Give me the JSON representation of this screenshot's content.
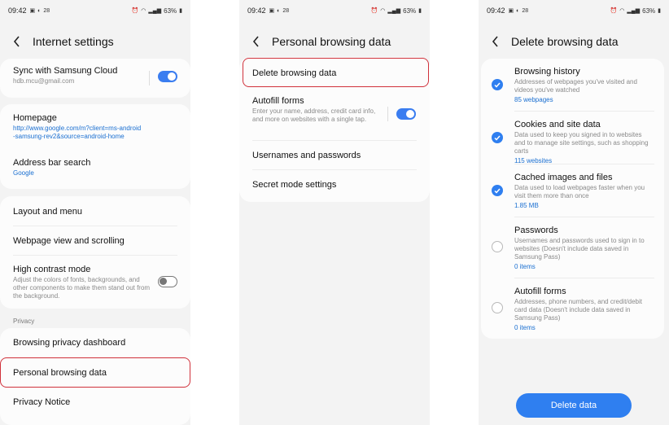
{
  "status_bar": {
    "time": "09:42",
    "temp": "28",
    "battery": "63%"
  },
  "screen1": {
    "title": "Internet settings",
    "sync": {
      "title": "Sync with Samsung Cloud",
      "account": "hdb.mcu@gmail.com",
      "enabled": true
    },
    "homepage": {
      "title": "Homepage",
      "url": "http://www.google.com/m?client=ms-android\n-samsung-rev2&source=android-home"
    },
    "address_bar": {
      "title": "Address bar search",
      "value": "Google"
    },
    "layout_menu": "Layout and menu",
    "webpage_view": "Webpage view and scrolling",
    "high_contrast": {
      "title": "High contrast mode",
      "description": "Adjust the colors of fonts, backgrounds, and other components to make them stand out from the background.",
      "enabled": false
    },
    "privacy_section": "Privacy",
    "privacy_dashboard": "Browsing privacy dashboard",
    "personal_data": "Personal browsing data",
    "privacy_notice": "Privacy Notice"
  },
  "screen2": {
    "title": "Personal browsing data",
    "delete_data": "Delete browsing data",
    "autofill": {
      "title": "Autofill forms",
      "description": "Enter your name, address, credit card info, and more on websites with a single tap.",
      "enabled": true
    },
    "passwords": "Usernames and passwords",
    "secret_mode": "Secret mode settings"
  },
  "screen3": {
    "title": "Delete browsing data",
    "items": [
      {
        "title": "Browsing history",
        "description": "Addresses of webpages you've visited and videos you've watched",
        "count": "85 webpages",
        "checked": true
      },
      {
        "title": "Cookies and site data",
        "description": "Data used to keep you signed in to websites and to manage site settings, such as shopping carts",
        "count": "115 websites",
        "checked": true
      },
      {
        "title": "Cached images and files",
        "description": "Data used to load webpages faster when you visit them more than once",
        "count": "1.85 MB",
        "checked": true
      },
      {
        "title": "Passwords",
        "description": "Usernames and passwords used to sign in to websites (Doesn't include data saved in Samsung Pass)",
        "count": "0 items",
        "checked": false
      },
      {
        "title": "Autofill forms",
        "description": "Addresses, phone numbers, and credit/debit card data (Doesn't include data saved in Samsung Pass)",
        "count": "0 items",
        "checked": false
      }
    ],
    "button": "Delete data"
  },
  "colors": {
    "accent": "#2f7ff0",
    "link": "#1a6fd1",
    "highlight_border": "#d0313b",
    "background": "#f3f3f3"
  }
}
